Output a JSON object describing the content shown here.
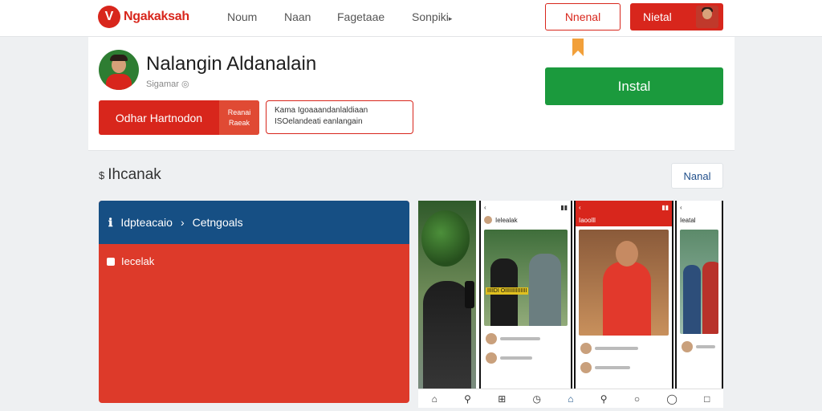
{
  "brand": {
    "name": "Ngakaksah",
    "mark": "V"
  },
  "nav": {
    "links": [
      "Noum",
      "Naan",
      "Fagetaae",
      "Sonpiki"
    ],
    "login_label": "Nnenal",
    "signup_label": "Nietal"
  },
  "profile": {
    "name": "Nalangin Aldanalain",
    "subtitle": "Sigamar ◎",
    "follow_label": "Odhar Hartnodon",
    "follow_side_line1": "Reanai",
    "follow_side_line2": "Raeak",
    "info_line1": "Kama Igoaaandanlaldiaan",
    "info_line2": "ISOelandeati eanlangain",
    "install_label": "Instal"
  },
  "section": {
    "title": "Ihcanak",
    "button_label": "Nanal"
  },
  "feature": {
    "head_left": "Idpteacaio",
    "head_right": "Cetngoals",
    "item": "Iecelak"
  },
  "shots": {
    "screen1_title": "Ielealak",
    "screen1_caption": "IIIIDI OIIIIIIIIIIIIII",
    "screen2_title": "Iaoolll",
    "screen3_title": "Ieatal"
  },
  "colors": {
    "primary_red": "#d8261c",
    "install_green": "#1b9a3d",
    "feature_blue": "#164f84"
  }
}
